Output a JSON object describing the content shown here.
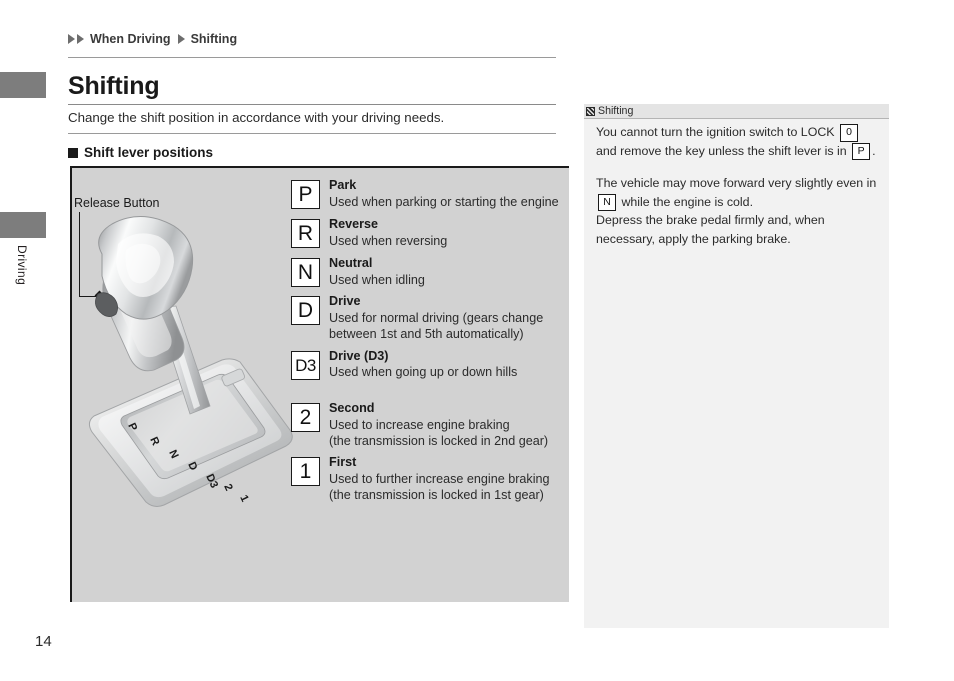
{
  "edge": {
    "section_label": "Driving"
  },
  "breadcrumb": {
    "items": [
      "When Driving",
      "Shifting"
    ]
  },
  "page": {
    "title": "Shifting",
    "intro": "Change the shift position in accordance with your driving needs.",
    "number": "14"
  },
  "subsection": {
    "title": "Shift lever positions"
  },
  "illustration": {
    "callout_label": "Release Button",
    "gate_markings": [
      "P",
      "R",
      "N",
      "D",
      "D3",
      "2",
      "1"
    ]
  },
  "gears": [
    {
      "symbol": "P",
      "name": "Park",
      "desc": "Used when parking or starting the engine"
    },
    {
      "symbol": "R",
      "name": "Reverse",
      "desc": "Used when reversing"
    },
    {
      "symbol": "N",
      "name": "Neutral",
      "desc": "Used when idling"
    },
    {
      "symbol": "D",
      "name": "Drive",
      "desc": "Used for normal driving (gears change between 1st and 5th automatically)"
    },
    {
      "symbol": "D3",
      "name": "Drive (D3)",
      "desc": "Used when going up or down hills"
    },
    {
      "symbol": "2",
      "name": "Second",
      "desc": "Used to increase engine braking",
      "desc2": "(the transmission is locked in 2nd gear)"
    },
    {
      "symbol": "1",
      "name": "First",
      "desc": "Used to further increase engine braking",
      "desc2": "(the transmission is locked in 1st gear)"
    }
  ],
  "note": {
    "header_title": "Shifting",
    "header_icon": "note-marker-icon",
    "para1_a": "You cannot turn the ignition switch to LOCK",
    "para1_box1": "0",
    "para1_b": "and remove the key unless the shift lever is in",
    "para1_box2": "P",
    "para1_c": ".",
    "para2_a": "The vehicle may move forward very slightly even in",
    "para2_box1": "N",
    "para2_b": "while the engine is cold.",
    "para2_c": "Depress the brake pedal firmly and, when necessary, apply the parking brake."
  },
  "colors": {
    "panel_bg": "#d2d2d2",
    "note_bg": "#f2f2f2",
    "tab_gray": "#7d7d7d",
    "ink": "#1a1a1a"
  }
}
